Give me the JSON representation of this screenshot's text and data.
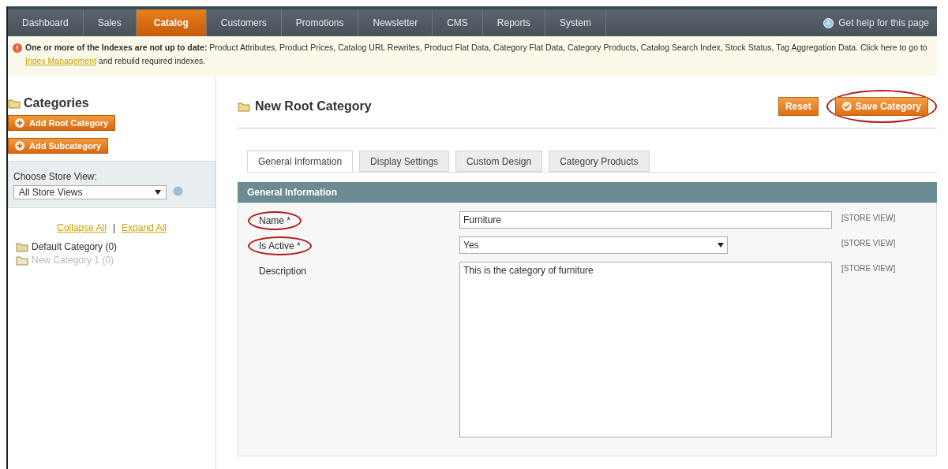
{
  "nav": {
    "items": [
      {
        "label": "Dashboard",
        "selected": false
      },
      {
        "label": "Sales",
        "selected": false
      },
      {
        "label": "Catalog",
        "selected": true
      },
      {
        "label": "Customers",
        "selected": false
      },
      {
        "label": "Promotions",
        "selected": false
      },
      {
        "label": "Newsletter",
        "selected": false
      },
      {
        "label": "CMS",
        "selected": false
      },
      {
        "label": "Reports",
        "selected": false
      },
      {
        "label": "System",
        "selected": false
      }
    ],
    "help": "Get help for this page"
  },
  "notice": {
    "bold": "One or more of the Indexes are not up to date:",
    "text": " Product Attributes, Product Prices, Catalog URL Rewrites, Product Flat Data, Category Flat Data, Category Products, Catalog Search Index, Stock Status, Tag Aggregation Data. Click here to go to ",
    "link": "Index Management",
    "tail": " and rebuild required indexes."
  },
  "sidebar": {
    "title": "Categories",
    "buttons": [
      "Add Root Category",
      "Add Subcategory"
    ],
    "store_label": "Choose Store View:",
    "store_value": "All Store Views",
    "collapse": "Collapse All",
    "separator": "|",
    "expand": "Expand All",
    "tree": [
      {
        "label": "Default Category (0)",
        "active": true
      },
      {
        "label": "New Category 1 (0)",
        "active": false
      }
    ]
  },
  "main": {
    "title": "New Root Category",
    "buttons": [
      {
        "label": "Reset",
        "circled": false,
        "kind": "plain"
      },
      {
        "label": "Save Category",
        "circled": true,
        "kind": "save"
      }
    ],
    "tabs": [
      {
        "label": "General Information",
        "selected": true
      },
      {
        "label": "Display Settings",
        "selected": false
      },
      {
        "label": "Custom Design",
        "selected": false
      },
      {
        "label": "Category Products",
        "selected": false
      }
    ],
    "section": "General Information",
    "fields": [
      {
        "kind": "text",
        "label": "Name *",
        "value": "Furniture",
        "scope": "[STORE VIEW]",
        "circled": true
      },
      {
        "kind": "select",
        "label": "Is Active *",
        "value": "Yes",
        "scope": "[STORE VIEW]",
        "circled": true
      },
      {
        "kind": "textarea",
        "label": "Description",
        "value": "This is the category of furniture",
        "scope": "[STORE VIEW]",
        "circled": false
      }
    ]
  }
}
